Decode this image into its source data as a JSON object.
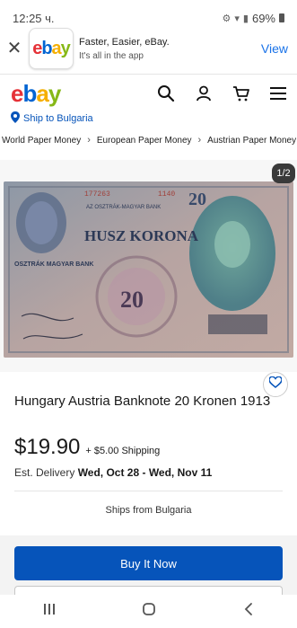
{
  "status_bar": {
    "time": "12:25 ч.",
    "battery": "69%"
  },
  "app_banner": {
    "title": "Faster, Easier, eBay.",
    "subtitle": "It's all in the app",
    "view_label": "View",
    "logo_letters": [
      "e",
      "b",
      "a",
      "y"
    ]
  },
  "header": {
    "logo_letters": [
      "e",
      "b",
      "a",
      "y"
    ]
  },
  "ship_to": {
    "label": "Ship to Bulgaria"
  },
  "breadcrumb": [
    "World Paper Money",
    "European Paper Money",
    "Austrian Paper Money"
  ],
  "gallery": {
    "counter": "1/2",
    "banknote_text": {
      "serial": "177263",
      "series": "1140",
      "denomination": "20",
      "main_line": "HUSZ KORONA",
      "bank_left": "OSZTRÁK MAGYAR BANK",
      "bank_top": "AZ OSZTRÁK-MAGYAR BANK"
    }
  },
  "listing": {
    "title": "Hungary Austria Banknote 20 Kronen 1913",
    "price": "$19.90",
    "shipping": "+ $5.00 Shipping",
    "delivery_label": "Est. Delivery ",
    "delivery_dates": "Wed, Oct 28 - Wed, Nov 11",
    "ships_from": "Ships from Bulgaria"
  },
  "buy": {
    "label": "Buy It Now"
  },
  "colors": {
    "ebay_red": "#e53238",
    "ebay_blue": "#0064d2",
    "ebay_yellow": "#f5af02",
    "ebay_green": "#86b817",
    "buy_button": "#0654ba",
    "link": "#1a73e8"
  },
  "icons": [
    "close-icon",
    "search-icon",
    "account-icon",
    "cart-icon",
    "menu-icon",
    "location-pin-icon",
    "chevron-right-icon",
    "heart-icon",
    "recents-icon",
    "home-icon",
    "back-icon"
  ]
}
